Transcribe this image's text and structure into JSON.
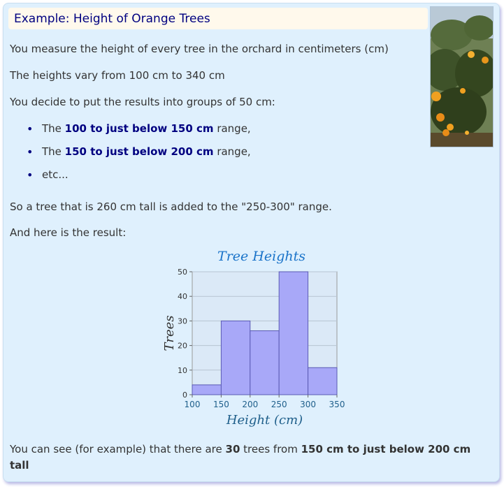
{
  "title": "Example: Height of Orange Trees",
  "paragraphs": {
    "p1": "You measure the height of every tree in the orchard in centimeters (cm)",
    "p2": "The heights vary from 100 cm to 340 cm",
    "p3": "You decide to put the results into groups of 50 cm:",
    "p4": "So a tree that is 260 cm tall is added to the \"250-300\" range.",
    "p5": "And here is the result:"
  },
  "bullets": [
    {
      "prefix": "The ",
      "bold": "100 to just below 150 cm",
      "suffix": " range,"
    },
    {
      "prefix": "The ",
      "bold": "150 to just below 200 cm",
      "suffix": " range,"
    },
    {
      "prefix": "etc...",
      "bold": "",
      "suffix": ""
    }
  ],
  "conclusion": {
    "prefix": "You can see (for example) that there are ",
    "bold1": "30",
    "middle": " trees from ",
    "bold2": "150 cm to just below 200 cm tall"
  },
  "colors": {
    "panel_bg": "#dff0fd",
    "title_bg": "#fff9ec",
    "title_text": "#000080",
    "bar_fill": "#a8a8f8",
    "bar_stroke": "#5a5ab4",
    "chart_title": "#1a73c9",
    "axis_label": "#1f5f8b"
  },
  "chart_data": {
    "type": "bar",
    "title": "Tree Heights",
    "xlabel": "Height (cm)",
    "ylabel": "Trees",
    "bins": [
      [
        100,
        150
      ],
      [
        150,
        200
      ],
      [
        200,
        250
      ],
      [
        250,
        300
      ],
      [
        300,
        350
      ]
    ],
    "values": [
      4,
      30,
      26,
      50,
      11
    ],
    "x_ticks": [
      100,
      150,
      200,
      250,
      300,
      350
    ],
    "y_ticks": [
      0,
      10,
      20,
      30,
      40,
      50
    ],
    "xlim": [
      100,
      350
    ],
    "ylim": [
      0,
      50
    ],
    "grid": true,
    "legend": "none"
  }
}
